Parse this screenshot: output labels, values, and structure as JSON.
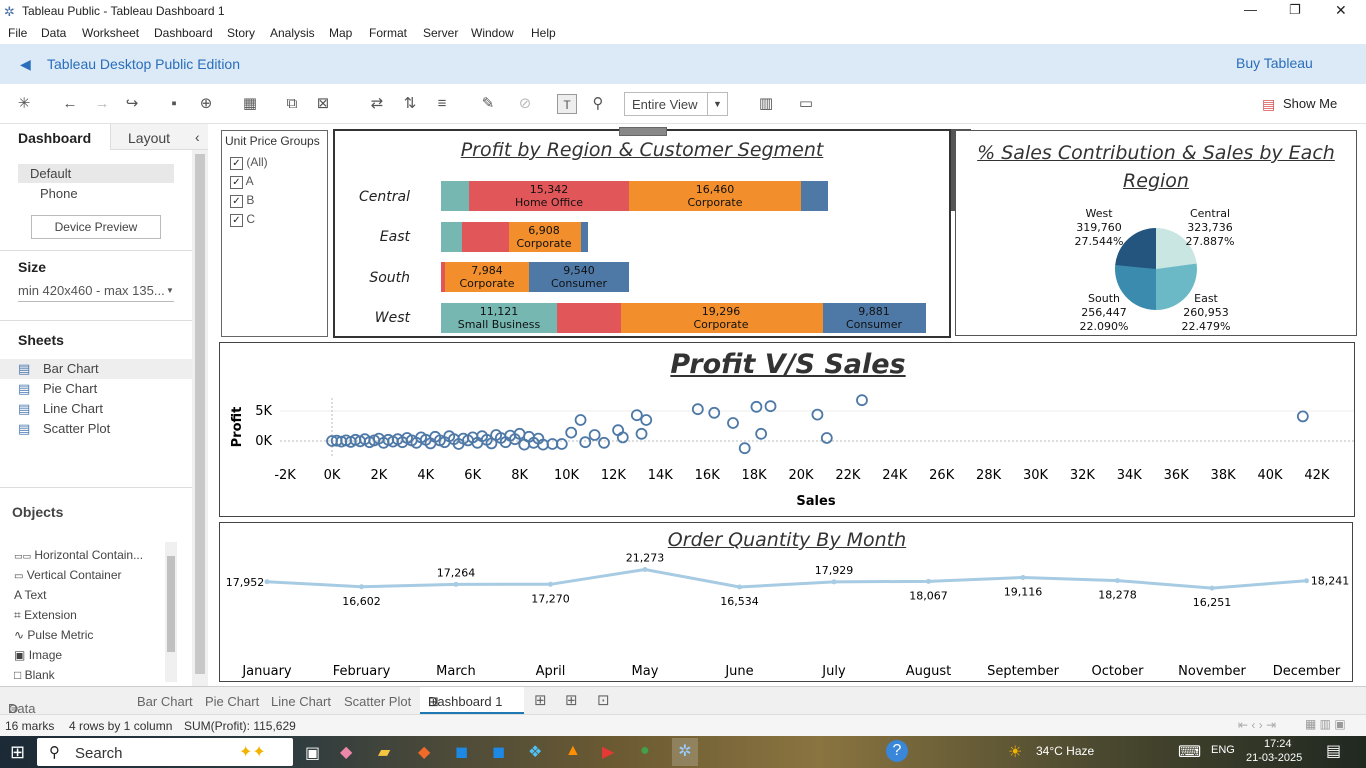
{
  "window": {
    "title": "Tableau Public - Tableau Dashboard 1",
    "min": "—",
    "max": "❐",
    "close": "✕"
  },
  "menu": [
    "File",
    "Data",
    "Worksheet",
    "Dashboard",
    "Story",
    "Analysis",
    "Map",
    "Format",
    "Server",
    "Window",
    "Help"
  ],
  "banner": {
    "edition": "Tableau Desktop Public Edition",
    "buy": "Buy Tableau"
  },
  "toolbar": {
    "fit": "Entire View",
    "show_me": "Show Me"
  },
  "left": {
    "tab_dashboard": "Dashboard",
    "tab_layout": "Layout",
    "device_default": "Default",
    "device_phone": "Phone",
    "device_preview": "Device Preview",
    "size_label": "Size",
    "size_value": "min 420x460 - max 135...",
    "sheets_label": "Sheets",
    "sheets": [
      "Bar Chart",
      "Pie Chart",
      "Line Chart",
      "Scatter Plot"
    ],
    "objects_label": "Objects",
    "objects": [
      {
        "icon": "▭▭",
        "label": "Horizontal Contain..."
      },
      {
        "icon": "▭",
        "label": "Vertical Container"
      },
      {
        "icon": "A",
        "label": "Text"
      },
      {
        "icon": "⌗",
        "label": "Extension"
      },
      {
        "icon": "∿",
        "label": "Pulse Metric"
      },
      {
        "icon": "▣",
        "label": "Image"
      },
      {
        "icon": "□",
        "label": "Blank"
      }
    ]
  },
  "filter": {
    "title": "Unit Price Groups",
    "options": [
      "(All)",
      "A",
      "B",
      "C"
    ]
  },
  "bar": {
    "title": "Profit by Region & Customer Segment",
    "regions": [
      "Central",
      "East",
      "South",
      "West"
    ],
    "labels": {
      "c_ho_val": "15,342",
      "c_ho": "Home Office",
      "c_co_val": "16,460",
      "c_co": "Corporate",
      "e_co_val": "6,908",
      "e_co": "Corporate",
      "s_co_val": "7,984",
      "s_co": "Corporate",
      "s_cn_val": "9,540",
      "s_cn": "Consumer",
      "w_sb_val": "11,121",
      "w_sb": "Small Business",
      "w_co_val": "19,296",
      "w_co": "Corporate",
      "w_cn_val": "9,881",
      "w_cn": "Consumer"
    }
  },
  "pie": {
    "title": "% Sales Contribution & Sales by Each Region",
    "slices": [
      {
        "region": "Central",
        "value": "323,736",
        "pct": "27.887%",
        "color": "#c9e6e2"
      },
      {
        "region": "East",
        "value": "260,953",
        "pct": "22.479%",
        "color": "#6bb9c6"
      },
      {
        "region": "South",
        "value": "256,447",
        "pct": "22.090%",
        "color": "#3b8bae"
      },
      {
        "region": "West",
        "value": "319,760",
        "pct": "27.544%",
        "color": "#24557e"
      }
    ]
  },
  "scatter": {
    "title": "Profit V/S Sales",
    "xlabel": "Sales",
    "ylabel": "Profit",
    "yticks": [
      "5K",
      "0K"
    ],
    "xticks": [
      "-2K",
      "0K",
      "2K",
      "4K",
      "6K",
      "8K",
      "10K",
      "12K",
      "14K",
      "16K",
      "18K",
      "20K",
      "22K",
      "24K",
      "26K",
      "28K",
      "30K",
      "32K",
      "34K",
      "36K",
      "38K",
      "40K",
      "42K"
    ]
  },
  "line": {
    "title": "Order Quantity By Month",
    "months": [
      "January",
      "February",
      "March",
      "April",
      "May",
      "June",
      "July",
      "August",
      "September",
      "October",
      "November",
      "December"
    ],
    "values": [
      "17,952",
      "16,602",
      "17,264",
      "17,270",
      "21,273",
      "16,534",
      "17,929",
      "18,067",
      "19,116",
      "18,278",
      "16,251",
      "18,241"
    ]
  },
  "tabs": {
    "data_source": "Data Source",
    "sheets": [
      "Bar Chart",
      "Pie Chart",
      "Line Chart",
      "Scatter Plot"
    ],
    "active": "Dashboard 1"
  },
  "status": {
    "marks": "16 marks",
    "rows": "4 rows by 1 column",
    "sum": "SUM(Profit): 115,629"
  },
  "taskbar": {
    "search": "Search",
    "weather": "34°C Haze",
    "lang": "ENG",
    "time": "17:24",
    "date": "21-03-2025"
  },
  "chart_data": [
    {
      "type": "bar",
      "title": "Profit by Region & Customer Segment",
      "categories": [
        "Central",
        "East",
        "South",
        "West"
      ],
      "series": [
        {
          "name": "Small Business",
          "values": [
            null,
            null,
            null,
            11121
          ]
        },
        {
          "name": "Home Office",
          "values": [
            15342,
            null,
            null,
            null
          ]
        },
        {
          "name": "Corporate",
          "values": [
            16460,
            6908,
            7984,
            19296
          ]
        },
        {
          "name": "Consumer",
          "values": [
            null,
            null,
            9540,
            9881
          ]
        }
      ]
    },
    {
      "type": "pie",
      "title": "% Sales Contribution & Sales by Each Region",
      "categories": [
        "Central",
        "East",
        "South",
        "West"
      ],
      "values": [
        323736,
        260953,
        256447,
        319760
      ]
    },
    {
      "type": "line",
      "title": "Order Quantity By Month",
      "categories": [
        "January",
        "February",
        "March",
        "April",
        "May",
        "June",
        "July",
        "August",
        "September",
        "October",
        "November",
        "December"
      ],
      "values": [
        17952,
        16602,
        17264,
        17270,
        21273,
        16534,
        17929,
        18067,
        19116,
        18278,
        16251,
        18241
      ]
    },
    {
      "type": "scatter",
      "title": "Profit V/S Sales",
      "xlabel": "Sales",
      "ylabel": "Profit",
      "xlim": [
        -3000,
        43000
      ],
      "points": [
        [
          0,
          0
        ],
        [
          200,
          50
        ],
        [
          400,
          -100
        ],
        [
          600,
          100
        ],
        [
          800,
          -150
        ],
        [
          1000,
          200
        ],
        [
          1200,
          -50
        ],
        [
          1400,
          300
        ],
        [
          1600,
          -200
        ],
        [
          1800,
          100
        ],
        [
          2000,
          400
        ],
        [
          2200,
          -300
        ],
        [
          2400,
          200
        ],
        [
          2600,
          -100
        ],
        [
          2800,
          300
        ],
        [
          3000,
          -200
        ],
        [
          3200,
          500
        ],
        [
          3400,
          100
        ],
        [
          3600,
          -300
        ],
        [
          3800,
          600
        ],
        [
          4000,
          200
        ],
        [
          4200,
          -400
        ],
        [
          4400,
          700
        ],
        [
          4600,
          100
        ],
        [
          4800,
          -200
        ],
        [
          5000,
          800
        ],
        [
          5200,
          300
        ],
        [
          5400,
          -500
        ],
        [
          5600,
          400
        ],
        [
          5800,
          100
        ],
        [
          6000,
          600
        ],
        [
          6200,
          -300
        ],
        [
          6400,
          800
        ],
        [
          6600,
          200
        ],
        [
          6800,
          -400
        ],
        [
          7000,
          1000
        ],
        [
          7200,
          500
        ],
        [
          7400,
          -200
        ],
        [
          7600,
          900
        ],
        [
          7800,
          300
        ],
        [
          8000,
          1200
        ],
        [
          8200,
          -600
        ],
        [
          8400,
          700
        ],
        [
          8600,
          -300
        ],
        [
          8800,
          400
        ],
        [
          9000,
          -600
        ],
        [
          9400,
          -500
        ],
        [
          9800,
          -500
        ],
        [
          10200,
          1400
        ],
        [
          10600,
          3500
        ],
        [
          10800,
          -200
        ],
        [
          11200,
          1000
        ],
        [
          11600,
          -300
        ],
        [
          12200,
          1800
        ],
        [
          12400,
          600
        ],
        [
          13000,
          4300
        ],
        [
          13200,
          1200
        ],
        [
          13400,
          3500
        ],
        [
          15600,
          5300
        ],
        [
          16300,
          4700
        ],
        [
          17100,
          3000
        ],
        [
          17600,
          -1200
        ],
        [
          18100,
          5700
        ],
        [
          18300,
          1200
        ],
        [
          18700,
          5800
        ],
        [
          20700,
          4400
        ],
        [
          21100,
          500
        ],
        [
          22600,
          6800
        ],
        [
          41400,
          4100
        ]
      ]
    }
  ]
}
